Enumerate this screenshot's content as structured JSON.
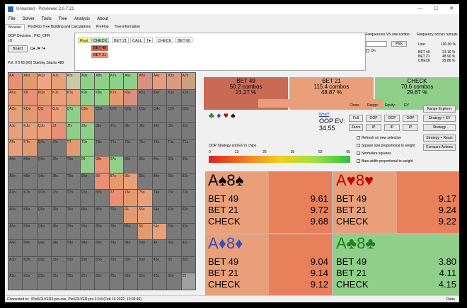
{
  "window": {
    "title": "Unnamed - PioViewer 2.0.7.21",
    "min": "—",
    "max": "☐",
    "close": "✕"
  },
  "menu": [
    "File",
    "Solver",
    "Tools",
    "Tree",
    "Analysis",
    "About"
  ],
  "tabs": [
    "Browser",
    "PostFlop Tree Building and Calculations",
    "PreFlop",
    "Tree information"
  ],
  "info": {
    "decision": "OOP Decision : PIO_CFR",
    "r": "r:0",
    "board_label": "Board",
    "suits": "Q♠ J♥ 7♦",
    "pot": "Pot: 0 0 65 (65) Starting Stacks 480"
  },
  "tree": {
    "nodes": [
      "Root",
      "CHECK",
      "BET 21",
      "CALL",
      "T♦",
      "CHECK",
      "BET 80"
    ],
    "subs": [
      "BET 49",
      "BET 21"
    ]
  },
  "freq": {
    "left_label": "Frequencies VS one combo",
    "right_label": "Frequency across runouts",
    "pick": "Pick",
    "on": "On",
    "line": "Line:",
    "rows": [
      {
        "label": "BET 49",
        "value": "21.16 %"
      },
      {
        "label": "BET 21",
        "value": "48.90 %"
      },
      {
        "label": "CHECK",
        "value": "29.86 %"
      }
    ],
    "line_value": "100.00 %"
  },
  "grid": [
    [
      "AA",
      "AKs",
      "AQs",
      "AJs",
      "ATs",
      "A9s",
      "A8s",
      "A7s",
      "A6s",
      "A5s",
      "A4s",
      "A3s",
      "A2s"
    ],
    [
      "AKo",
      "KK",
      "KQs",
      "KJs",
      "KTs",
      "K9s",
      "K8s",
      "K7s",
      "K6s",
      "K5s",
      "K4s",
      "K3s",
      "K2s"
    ],
    [
      "AQo",
      "KQo",
      "QQ",
      "QJs",
      "QTs",
      "Q9s",
      "Q8s",
      "Q7s",
      "Q6s",
      "Q5s",
      "Q4s",
      "Q3s",
      "Q2s"
    ],
    [
      "AJo",
      "KJo",
      "QJo",
      "JJ",
      "JTs",
      "J9s",
      "J8s",
      "J7s",
      "J6s",
      "J5s",
      "J4s",
      "J3s",
      "J2s"
    ],
    [
      "ATo",
      "KTo",
      "QTo",
      "JTo",
      "TT",
      "T9s",
      "T8s",
      "T7s",
      "T6s",
      "T5s",
      "T4s",
      "T3s",
      "T2s"
    ],
    [
      "A9o",
      "K9o",
      "Q9o",
      "J9o",
      "T9o",
      "99",
      "98s",
      "97s",
      "96s",
      "95s",
      "94s",
      "93s",
      "92s"
    ],
    [
      "A8o",
      "K8o",
      "Q8o",
      "J8o",
      "T8o",
      "98o",
      "88",
      "87s",
      "86s",
      "85s",
      "84s",
      "83s",
      "82s"
    ],
    [
      "A7o",
      "K7o",
      "Q7o",
      "J7o",
      "T7o",
      "97o",
      "87o",
      "77",
      "76s",
      "75s",
      "74s",
      "73s",
      "72s"
    ],
    [
      "A6o",
      "K6o",
      "Q6o",
      "J6o",
      "T6o",
      "96o",
      "86o",
      "76o",
      "66",
      "65s",
      "64s",
      "63s",
      "62s"
    ],
    [
      "A5o",
      "K5o",
      "Q5o",
      "J5o",
      "T5o",
      "95o",
      "85o",
      "75o",
      "65o",
      "55",
      "54s",
      "53s",
      "52s"
    ],
    [
      "A4o",
      "K4o",
      "Q4o",
      "J4o",
      "T4o",
      "94o",
      "84o",
      "74o",
      "64o",
      "54o",
      "44",
      "43s",
      "42s"
    ],
    [
      "A3o",
      "K3o",
      "Q3o",
      "J3o",
      "T3o",
      "93o",
      "83o",
      "73o",
      "63o",
      "53o",
      "43o",
      "33",
      "32s"
    ],
    [
      "A2o",
      "K2o",
      "Q2o",
      "J2o",
      "T2o",
      "92o",
      "82o",
      "72o",
      "62o",
      "52o",
      "42o",
      "32o",
      "22"
    ]
  ],
  "actions": [
    {
      "label": "BET 49",
      "combos": "50.2 combos",
      "pct": "21.27 %",
      "color": "#c96a55",
      "share": 0.2127
    },
    {
      "label": "BET 21",
      "combos": "115.4 combos",
      "pct": "48.87 %",
      "color": "#e9a07a",
      "share": 0.4887
    },
    {
      "label": "CHECK",
      "combos": "70.6 combos",
      "pct": "29.87 %",
      "color": "#8fcf8a",
      "share": 0.2987
    }
  ],
  "ev": {
    "what": "What?",
    "label": "OOP EV:",
    "value": "34.55"
  },
  "controls": {
    "clone": "Clone:",
    "range": "Range:",
    "equity": "Equity:",
    "ev": "EV",
    "full": "Full",
    "zoom": "Zoom",
    "ip1": "IP",
    "ip2": "IP",
    "ip3": "IP",
    "oop1": "OOP",
    "oop2": "OOP",
    "oop3": "OOP",
    "range_explorer": "Range Explorer",
    "strat_ev": "Strategy + EV",
    "strategy": "Strategy",
    "strat_react": "Strategy + React",
    "compare": "Compare Actions"
  },
  "checks": [
    "Refresh on new selection",
    "Square size proportional to weight",
    "Normalize squares",
    "Bars width proportional to weight"
  ],
  "heat": {
    "label": "OOP Strategy and EV in chips",
    "ticks": [
      "0",
      "13",
      "26",
      "39",
      "52",
      "65"
    ]
  },
  "cards": [
    {
      "title": "A♠8♠",
      "color": "#000",
      "rows": [
        [
          "BET 49",
          "9.61"
        ],
        [
          "BET 21",
          "9.72"
        ],
        [
          "CHECK",
          "9.68"
        ]
      ]
    },
    {
      "title": "A♥8♥",
      "color": "#c00000",
      "rows": [
        [
          "BET 49",
          "9.17"
        ],
        [
          "BET 21",
          "9.24"
        ],
        [
          "CHECK",
          "9.22"
        ]
      ]
    },
    {
      "title": "A♦8♦",
      "color": "#3050c0",
      "rows": [
        [
          "BET 49",
          "9.04"
        ],
        [
          "BET 21",
          "9.14"
        ],
        [
          "CHECK",
          "9.12"
        ]
      ]
    },
    {
      "title": "A♣8♣",
      "color": "#208020",
      "rows": [
        [
          "BET 49",
          "3.80"
        ],
        [
          "BET 21",
          "4.11"
        ],
        [
          "CHECK",
          "4.15"
        ]
      ]
    }
  ],
  "status": {
    "left": "Connected to: .\\PioSOLVER2-pro.exe, PioSOLVER-pro 2.0.8 (Feb 16 2022, 13:03:45)",
    "right": "Done"
  }
}
